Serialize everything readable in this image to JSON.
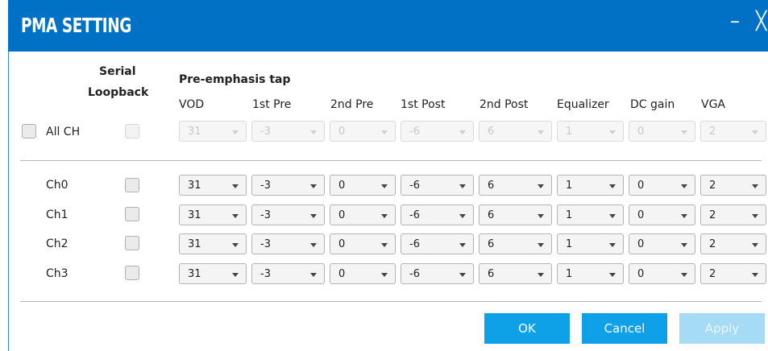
{
  "window": {
    "title": "PMA SETTING",
    "minimize_glyph": "–",
    "close_glyph": "╳"
  },
  "header": {
    "serial_loopback_line1": "Serial",
    "serial_loopback_line2": "Loopback",
    "preemphasis_label": "Pre-emphasis tap",
    "columns": [
      "VOD",
      "1st Pre",
      "2nd Pre",
      "1st Post",
      "2nd Post",
      "Equalizer",
      "DC gain",
      "VGA"
    ]
  },
  "all_ch": {
    "label": "All CH",
    "values": [
      "31",
      "-3",
      "0",
      "-6",
      "6",
      "1",
      "0",
      "2"
    ]
  },
  "channels": [
    {
      "name": "Ch0",
      "values": [
        "31",
        "-3",
        "0",
        "-6",
        "6",
        "1",
        "0",
        "2"
      ]
    },
    {
      "name": "Ch1",
      "values": [
        "31",
        "-3",
        "0",
        "-6",
        "6",
        "1",
        "0",
        "2"
      ]
    },
    {
      "name": "Ch2",
      "values": [
        "31",
        "-3",
        "0",
        "-6",
        "6",
        "1",
        "0",
        "2"
      ]
    },
    {
      "name": "Ch3",
      "values": [
        "31",
        "-3",
        "0",
        "-6",
        "6",
        "1",
        "0",
        "2"
      ]
    }
  ],
  "buttons": {
    "ok": "OK",
    "cancel": "Cancel",
    "apply": "Apply"
  },
  "colors": {
    "titlebar": "#0071c5",
    "button": "#0ea1e8",
    "button_disabled": "#a6dbf5"
  }
}
